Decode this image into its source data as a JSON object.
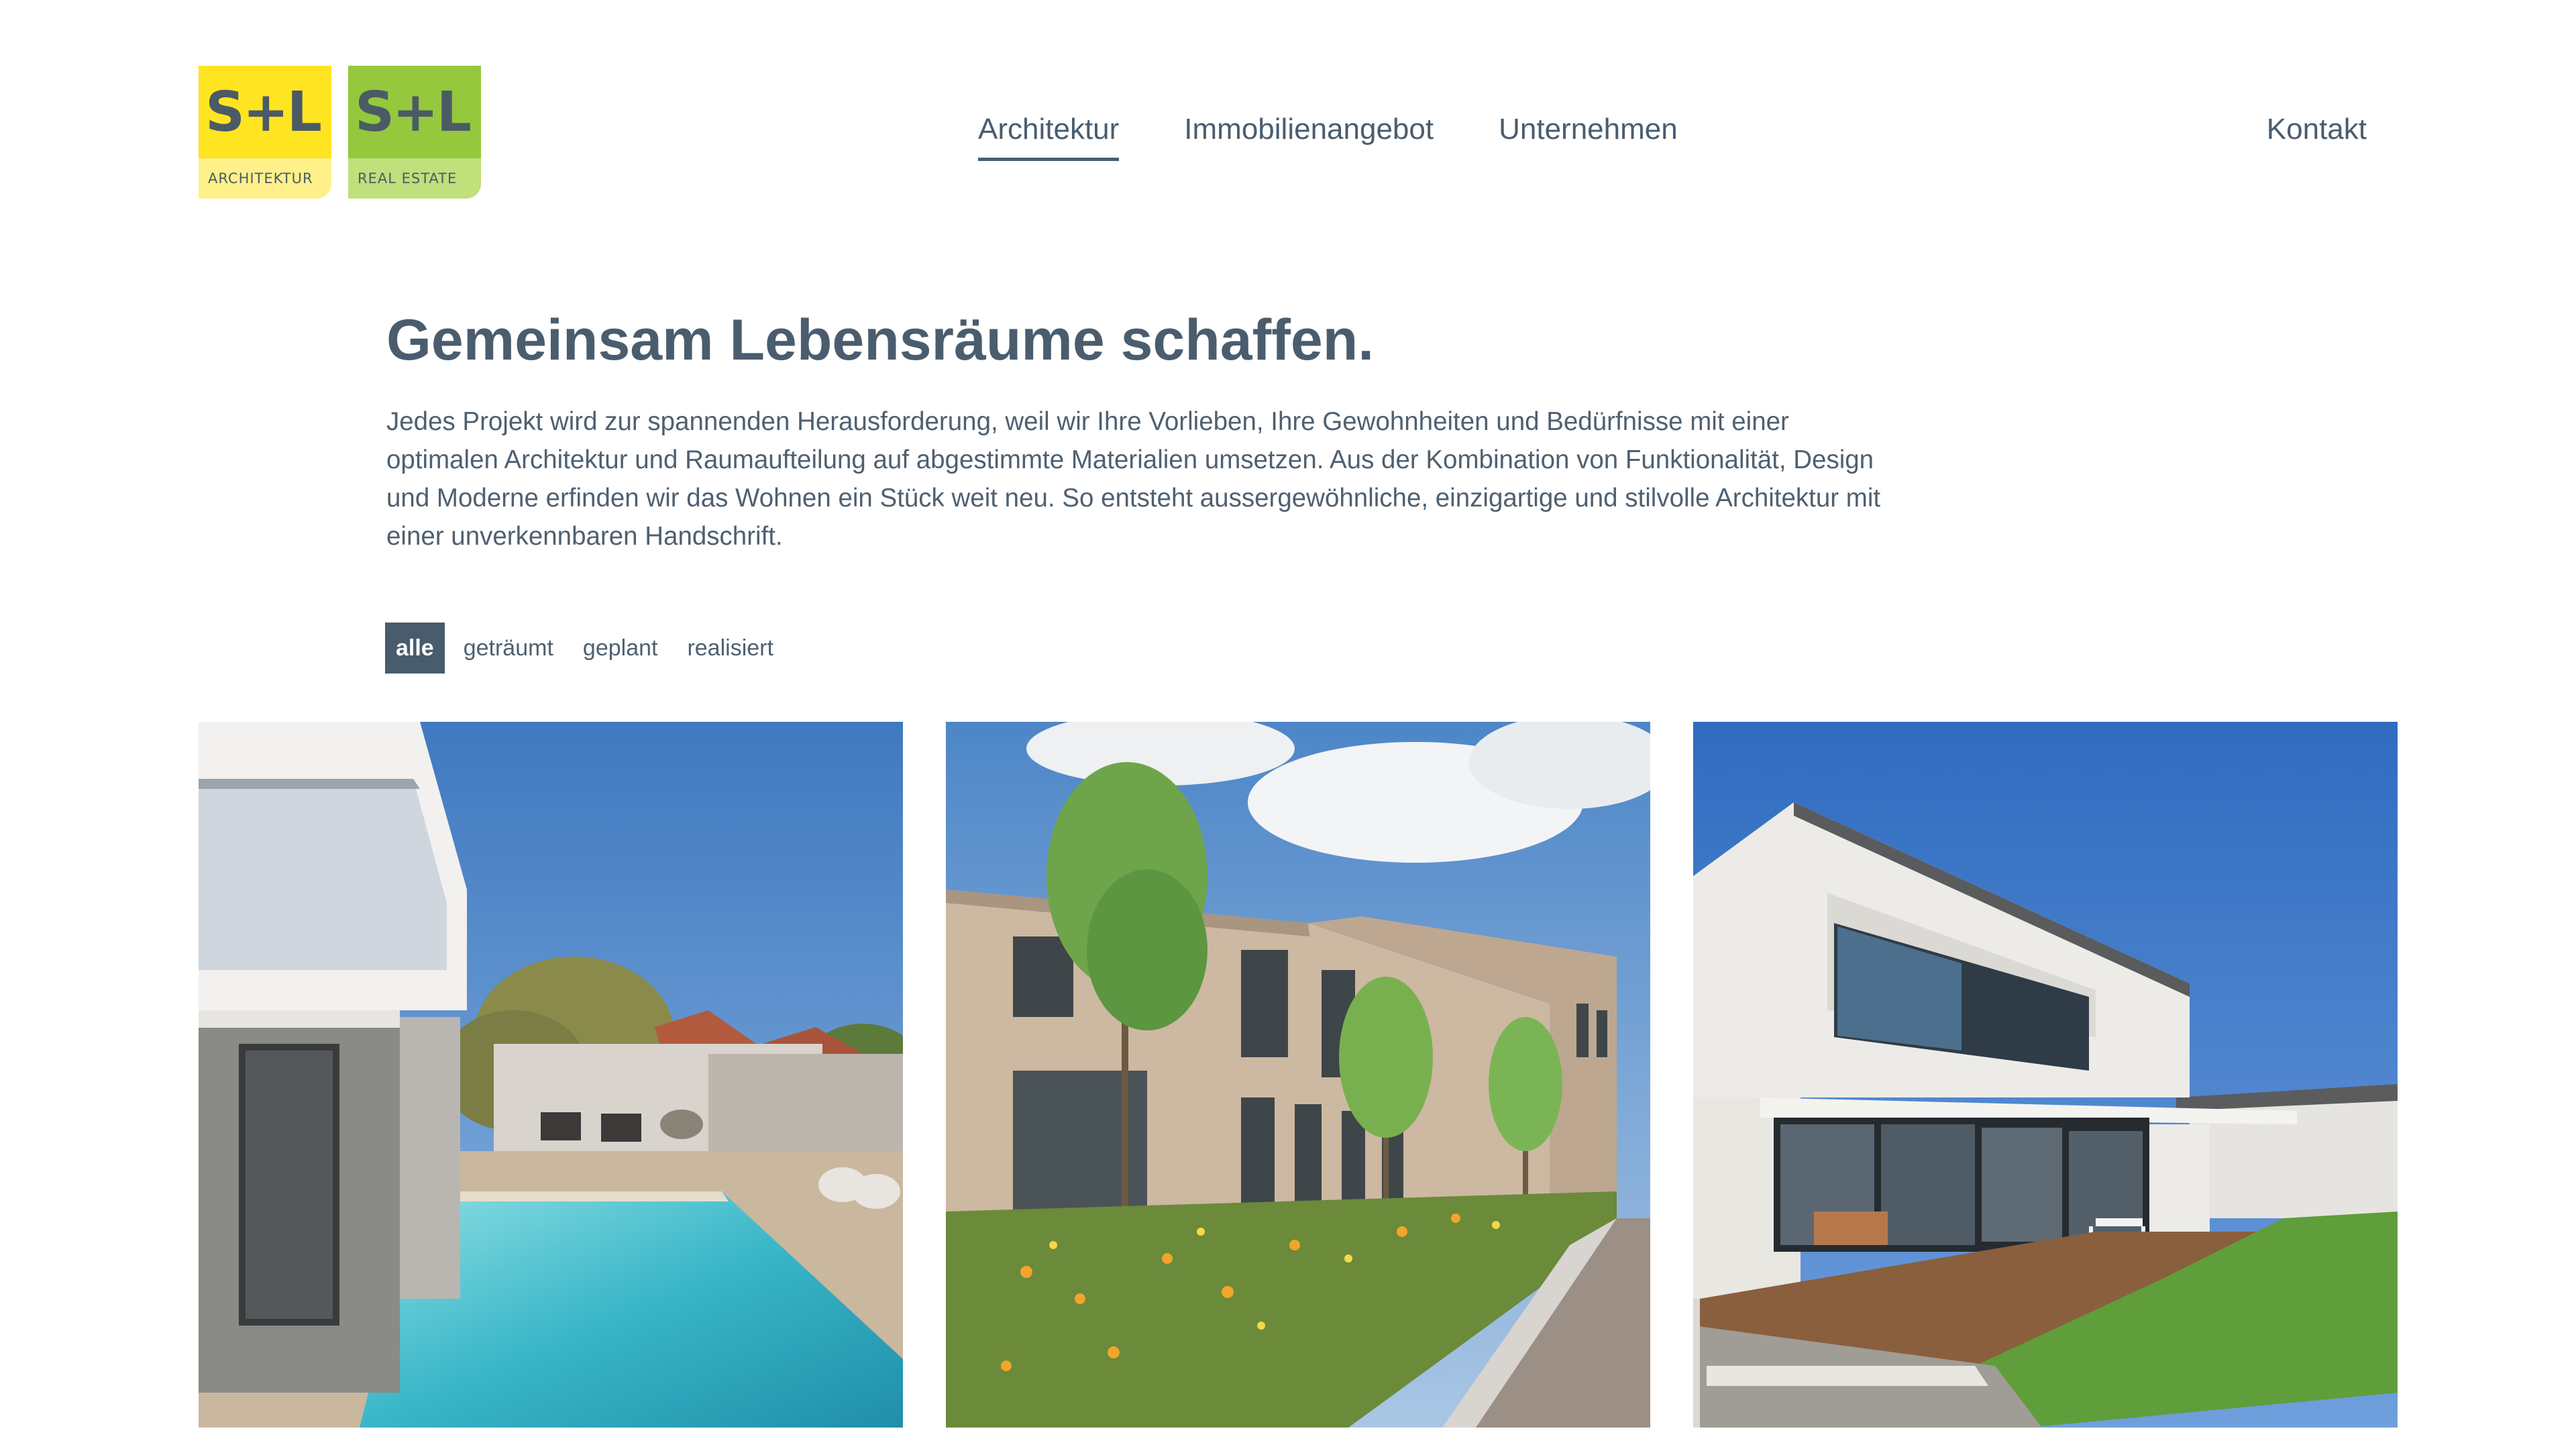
{
  "logos": [
    {
      "mark": "S+L",
      "subtitle": "ARCHITEKTUR"
    },
    {
      "mark": "S+L",
      "subtitle": "REAL ESTATE"
    }
  ],
  "nav": {
    "items": [
      {
        "label": "Architektur"
      },
      {
        "label": "Immobilienangebot"
      },
      {
        "label": "Unternehmen"
      }
    ],
    "contact": "Kontakt"
  },
  "hero": {
    "title": "Gemeinsam Lebensräume schaffen.",
    "text": "Jedes Projekt wird zur spannenden Herausforderung, weil wir Ihre Vorlieben, Ihre Gewohnheiten und Bedürfnisse mit einer optimalen Architektur und Raumaufteilung auf abgestimmte Materialien umsetzen. Aus der Kombination von Funktionalität, Design und Moderne erfinden wir das Wohnen ein Stück weit neu. So entsteht aussergewöhnliche, einzigartige und stilvolle Architektur mit einer unverkennbaren Handschrift."
  },
  "filters": [
    {
      "label": "alle"
    },
    {
      "label": "geträumt"
    },
    {
      "label": "geplant"
    },
    {
      "label": "realisiert"
    }
  ],
  "colors": {
    "text": "#4a5d6e",
    "filter_active_bg": "#485c6e",
    "logo_architektur": "#ffe421",
    "logo_real_estate": "#95c83c"
  }
}
